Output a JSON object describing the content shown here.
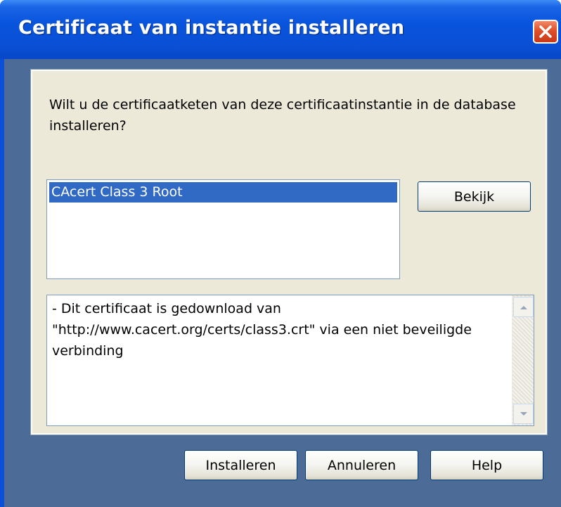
{
  "window": {
    "title": "Certificaat van instantie installeren"
  },
  "dialog": {
    "prompt": "Wilt u de certificaatketen van deze certificaatinstantie in de database installeren?",
    "certificates": [
      {
        "label": "CAcert Class 3 Root",
        "selected": true
      }
    ],
    "view_label": "Bekijk",
    "details": "- Dit certificaat is gedownload van \"http://www.cacert.org/certs/class3.crt\" via een niet beveiligde verbinding"
  },
  "buttons": {
    "install_label": "Installeren",
    "cancel_label": "Annuleren",
    "help_label": "Help"
  },
  "icons": {
    "close": "close-icon",
    "scroll_up": "scroll-up-arrow-icon",
    "scroll_down": "scroll-down-arrow-icon"
  },
  "colors": {
    "titlebar": "#0a4fd8",
    "selection": "#316ac5",
    "close_button": "#e0502a",
    "dialog_background": "#ece9d8"
  }
}
